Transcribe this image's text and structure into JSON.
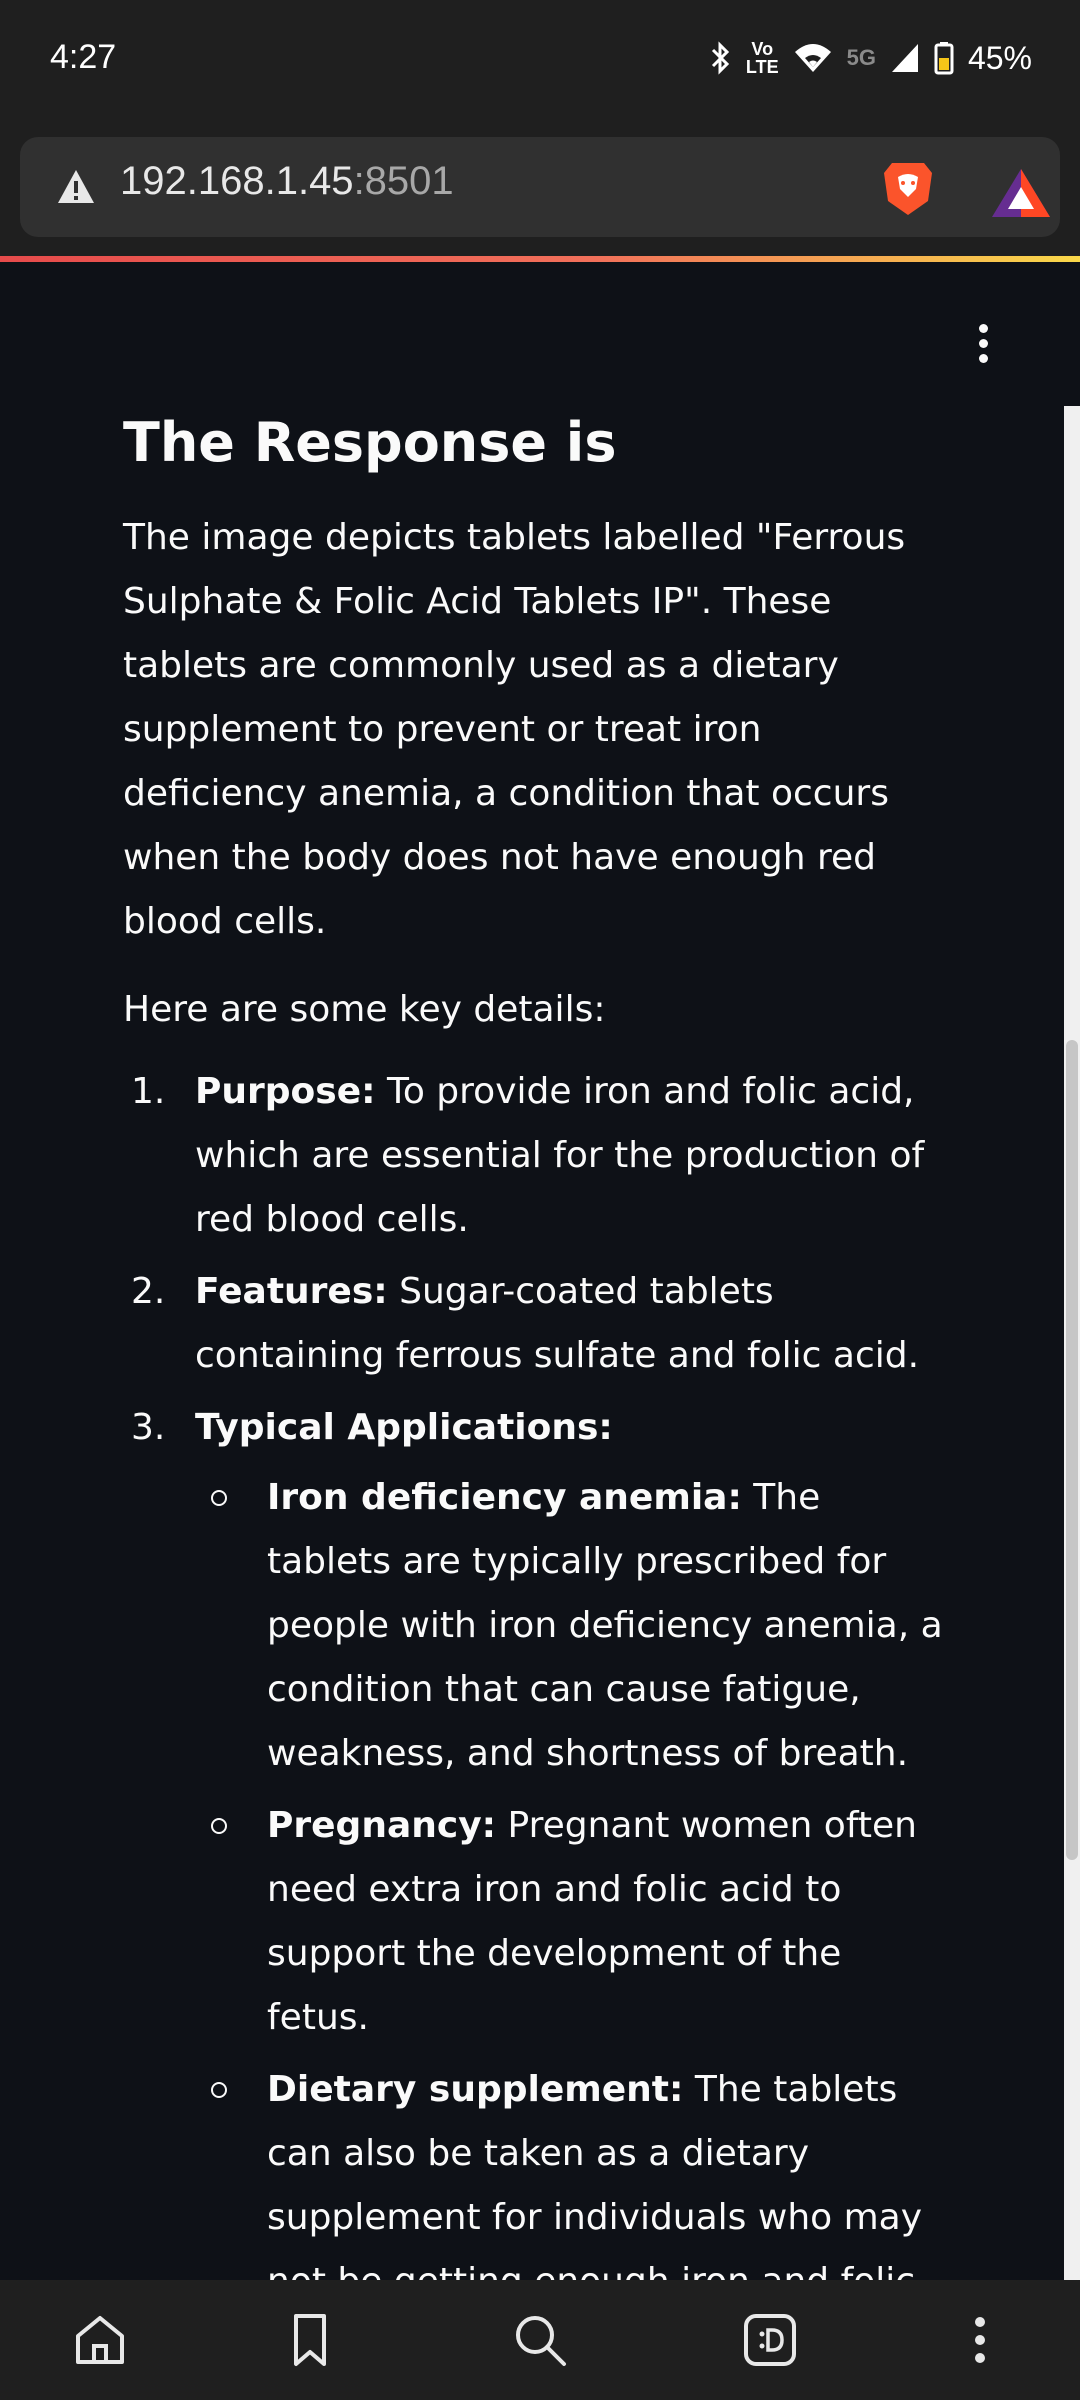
{
  "status_bar": {
    "time": "4:27",
    "volte_line1": "Vo",
    "volte_line2": "LTE",
    "network": "5G",
    "battery": "45%"
  },
  "url_bar": {
    "host": "192.168.1.45",
    "port": ":8501"
  },
  "page": {
    "title": "The Response is",
    "paragraph": "The image depicts tablets labelled \"Ferrous Sulphate & Folic Acid Tablets IP\". These tablets are commonly used as a dietary supplement to prevent or treat iron deficiency anemia, a condition that occurs when the body does not have enough red blood cells.",
    "lead": "Here are some key details:",
    "list": [
      {
        "num": "1.",
        "label": "Purpose:",
        "text": " To provide iron and folic acid, which are essential for the production of red blood cells."
      },
      {
        "num": "2.",
        "label": "Features:",
        "text": " Sugar-coated tablets containing ferrous sulfate and folic acid."
      },
      {
        "num": "3.",
        "label": "Typical Applications:",
        "text": ""
      }
    ],
    "sublist": [
      {
        "label": "Iron deficiency anemia:",
        "text": " The tablets are typically prescribed for people with iron deficiency anemia, a condition that can cause fatigue, weakness, and shortness of breath."
      },
      {
        "label": "Pregnancy:",
        "text": " Pregnant women often need extra iron and folic acid to support the development of the fetus."
      },
      {
        "label": "Dietary supplement:",
        "text": " The tablets can also be taken as a dietary supplement for individuals who may not be getting enough iron and folic acid from their diet."
      }
    ]
  },
  "icons": {
    "kebab": "more-vert-icon",
    "home": "home-icon",
    "bookmark": "bookmark-icon",
    "search": "search-icon",
    "tabs": "tabs-icon",
    "menu": "more-vert-icon"
  },
  "colors": {
    "page_bg": "#0e1117",
    "chrome_bg": "#1f1f1f",
    "text": "#fafafa",
    "progress_start": "#e64b4b",
    "progress_end": "#f9d84a"
  }
}
